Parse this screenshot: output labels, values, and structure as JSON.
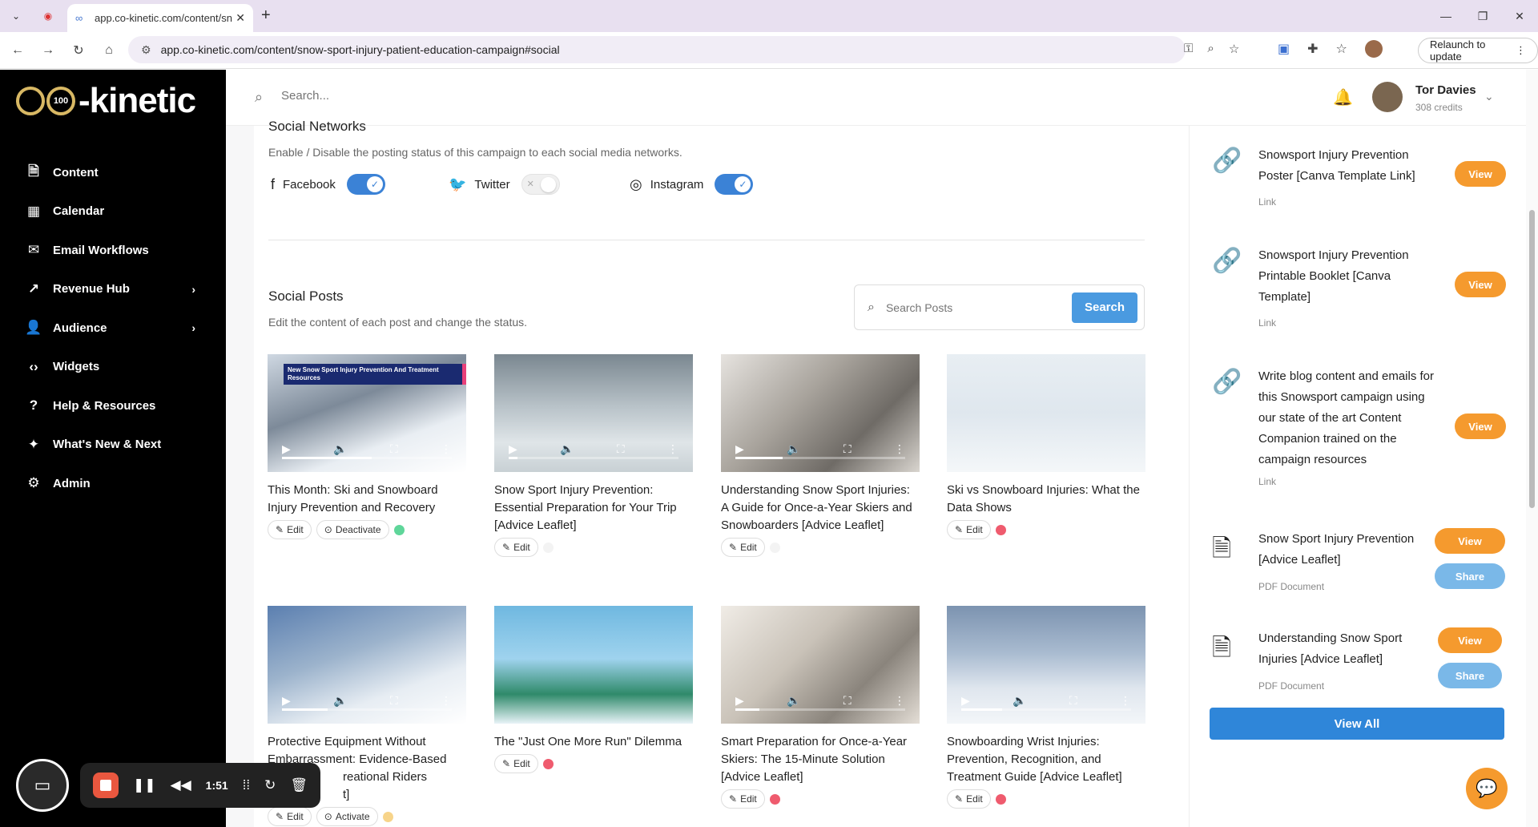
{
  "browser": {
    "tab_title": "app.co-kinetic.com/content/sn",
    "url": "app.co-kinetic.com/content/snow-sport-injury-patient-education-campaign#social",
    "relaunch_label": "Relaunch to update"
  },
  "brand": {
    "logo_text": "-kinetic",
    "logo_badge": "100",
    "accent": "#f59a2e",
    "primary": "#2f86d9"
  },
  "sidebar": {
    "items": [
      {
        "label": "Content",
        "icon": "document-icon"
      },
      {
        "label": "Calendar",
        "icon": "calendar-icon"
      },
      {
        "label": "Email Workflows",
        "icon": "mail-icon"
      },
      {
        "label": "Revenue Hub",
        "icon": "trend-icon"
      },
      {
        "label": "Audience",
        "icon": "users-icon"
      },
      {
        "label": "Widgets",
        "icon": "code-icon"
      },
      {
        "label": "Help & Resources",
        "icon": "help-icon"
      },
      {
        "label": "What's New & Next",
        "icon": "sparkle-icon"
      },
      {
        "label": "Admin",
        "icon": "gear-icon"
      }
    ]
  },
  "recorder": {
    "time": "1:51"
  },
  "topbar": {
    "search_placeholder": "Search...",
    "user_name": "Tor Davies",
    "user_credits": "308 credits"
  },
  "social_networks": {
    "title": "Social Networks",
    "subtitle": "Enable / Disable the posting status of this campaign to each social media networks.",
    "networks": [
      {
        "name": "Facebook",
        "enabled": true
      },
      {
        "name": "Twitter",
        "enabled": false
      },
      {
        "name": "Instagram",
        "enabled": true
      }
    ]
  },
  "social_posts": {
    "title": "Social Posts",
    "subtitle": "Edit the content of each post and change the status.",
    "search_placeholder": "Search Posts",
    "search_label": "Search",
    "edit_label": "Edit",
    "deactivate_label": "Deactivate",
    "activate_label": "Activate",
    "thumb_badge": "New Snow Sport Injury Prevention And Treatment Resources",
    "posts": [
      {
        "title": "This Month: Ski and Snowboard Injury Prevention and Recovery",
        "status": "green",
        "progress": 0.53
      },
      {
        "title": "Snow Sport Injury Prevention: Essential Preparation for Your Trip [Advice Leaflet]",
        "status": "empty",
        "progress": 0.05
      },
      {
        "title": "Understanding Snow Sport Injuries: A Guide for Once-a-Year Skiers and Snowboarders [Advice Leaflet]",
        "status": "empty",
        "progress": 0.28
      },
      {
        "title": "Ski vs Snowboard Injuries: What the Data Shows",
        "status": "red",
        "progress": 0
      },
      {
        "title": "Protective Equipment Without Embarrassment: Evidence-Based Recreational Riders",
        "title_fragments": [
          "Protective Equipment Without",
          "Embarrassment: Evidence-Based",
          "reational Riders",
          "t]"
        ],
        "status": "yellow",
        "progress": 0.27
      },
      {
        "title": "The \"Just One More Run\" Dilemma",
        "status": "red",
        "progress": 0
      },
      {
        "title": "Smart Preparation for Once-a-Year Skiers: The 15-Minute Solution [Advice Leaflet]",
        "status": "red",
        "progress": 0.14
      },
      {
        "title": "Snowboarding Wrist Injuries: Prevention, Recognition, and Treatment Guide [Advice Leaflet]",
        "status": "red",
        "progress": 0.24
      }
    ]
  },
  "resources": {
    "view_label": "View",
    "share_label": "Share",
    "view_all_label": "View All",
    "items": [
      {
        "title": "Snowsport Injury Prevention Poster [Canva Template Link]",
        "type": "Link",
        "icon": "link-icon"
      },
      {
        "title": "Snowsport Injury Prevention Printable Booklet [Canva Template]",
        "type": "Link",
        "icon": "link-icon"
      },
      {
        "title": "Write blog content and emails for this Snowsport campaign using our state of the art Content Companion trained on the campaign resources",
        "type": "Link",
        "icon": "link-icon"
      },
      {
        "title": "Snow Sport Injury Prevention [Advice Leaflet]",
        "type": "PDF Document",
        "icon": "file-icon"
      },
      {
        "title": "Understanding Snow Sport Injuries [Advice Leaflet]",
        "type": "PDF Document",
        "icon": "file-icon"
      }
    ]
  }
}
